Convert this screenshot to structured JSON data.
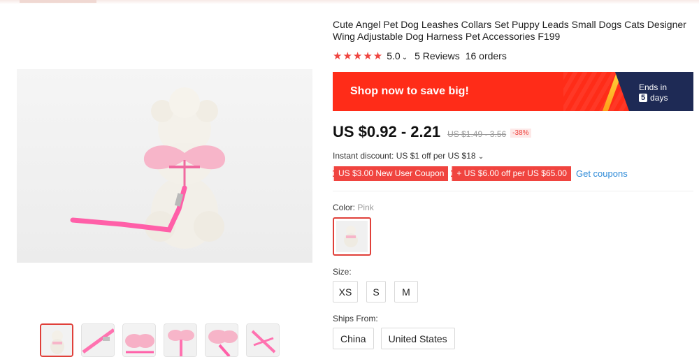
{
  "product": {
    "title": "Cute Angel Pet Dog Leashes Collars Set Puppy Leads Small Dogs Cats Designer Wing Adjustable Dog Harness Pet Accessories F199",
    "stars": "★★★★★",
    "rating": "5.0",
    "reviews": "5 Reviews",
    "orders": "16 orders"
  },
  "promo": {
    "text": "Shop now to save big!",
    "ends_label": "Ends in",
    "ends_number": "5",
    "ends_unit": "days",
    "colors": {
      "banner": "#ff2c18",
      "badge": "#1e2a55"
    }
  },
  "price": {
    "current": "US $0.92 - 2.21",
    "original": "US $1.49 - 3.56",
    "discount": "-38%"
  },
  "instant_discount": "Instant discount: US $1 off per US $18",
  "coupons": {
    "new_user": "US $3.00 New User Coupon",
    "store": "+ US $6.00 off per US $65.00",
    "get_link": "Get coupons"
  },
  "color": {
    "label": "Color:",
    "value": "Pink"
  },
  "size": {
    "label": "Size:",
    "options": [
      "XS",
      "S",
      "M"
    ]
  },
  "ships": {
    "label": "Ships From:",
    "options": [
      "China",
      "United States"
    ]
  },
  "gallery": {
    "thumbnail_count": 6,
    "accent_color": "#e0403a"
  }
}
